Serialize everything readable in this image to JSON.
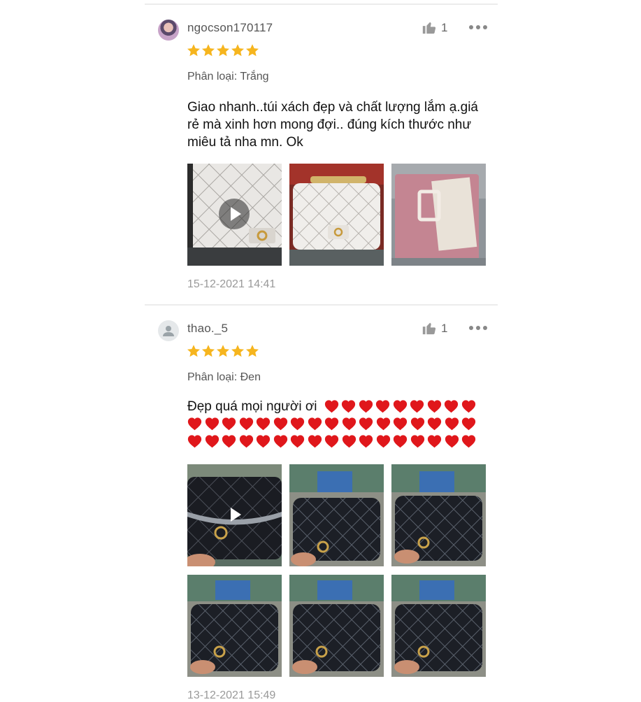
{
  "reviews": [
    {
      "username": "ngocson170117",
      "likes": "1",
      "rating": 5,
      "variant": "Phân loại: Trắng",
      "comment": "Giao nhanh..túi xách đẹp và chất lượng lắm ạ.giá rẻ mà xinh hơn mong đợi.. đúng kích thước như miêu tả nha mn. Ok",
      "media": [
        "video-thumbnail",
        "photo",
        "photo"
      ],
      "date": "15-12-2021 14:41"
    },
    {
      "username": "thao._5",
      "likes": "1",
      "rating": 5,
      "variant": "Phân loại: Đen",
      "comment": "Đẹp quá mọi người  ơi",
      "heart_rows": [
        9,
        17,
        17
      ],
      "media": [
        "video-thumbnail",
        "photo",
        "photo",
        "photo",
        "photo",
        "photo"
      ],
      "date": "13-12-2021 15:49"
    }
  ],
  "icons": {
    "like": "thumbs-up-icon",
    "more": "more-options-icon",
    "star": "star-icon",
    "heart": "red-heart-emoji",
    "play": "play-icon"
  },
  "colors": {
    "star": "#f6b51e",
    "heart": "#e0171b",
    "divider": "#ececec",
    "date": "#999999"
  }
}
